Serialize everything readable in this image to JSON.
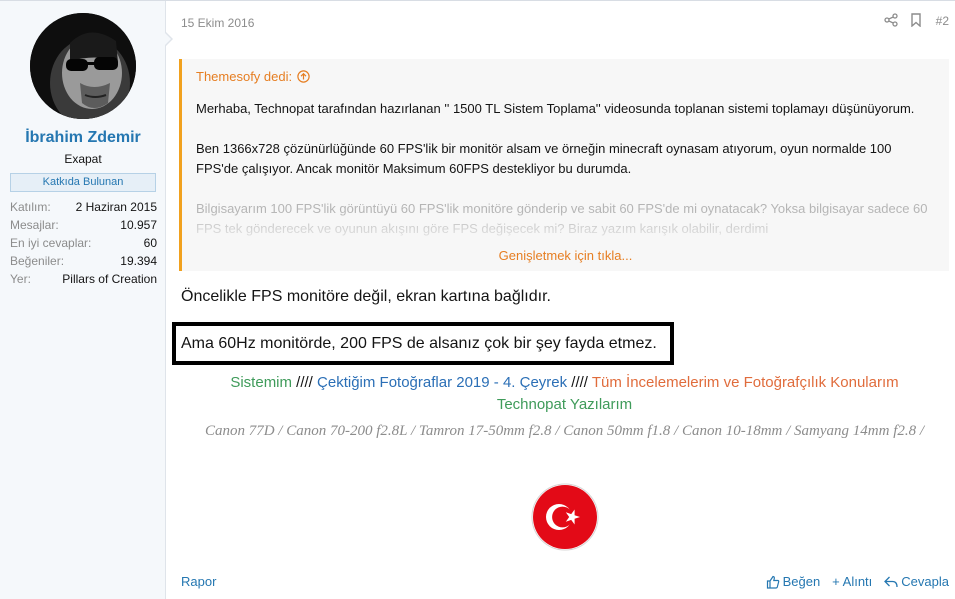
{
  "user": {
    "name": "İbrahim Zdemir",
    "title": "Exapat",
    "banner": "Katkıda Bulunan",
    "stats": [
      {
        "key": "Katılım:",
        "value": "2 Haziran 2015"
      },
      {
        "key": "Mesajlar:",
        "value": "10.957"
      },
      {
        "key": "En iyi cevaplar:",
        "value": "60"
      },
      {
        "key": "Beğeniler:",
        "value": "19.394"
      },
      {
        "key": "Yer:",
        "value": "Pillars of Creation"
      }
    ]
  },
  "post": {
    "date": "15 Ekim 2016",
    "number": "#2",
    "quote": {
      "author": "Themesofy dedi:",
      "paragraphs": [
        "Merhaba, Technopat tarafından hazırlanan '' 1500 TL Sistem Toplama'' videosunda toplanan sistemi toplamayı düşünüyorum.",
        "Ben 1366x728 çözünürlüğünde 60 FPS'lik bir monitör alsam ve örneğin minecraft oynasam atıyorum, oyun normalde 100 FPS'de çalışıyor. Ancak monitör Maksimum 60FPS destekliyor bu durumda.",
        "Bilgisayarım 100 FPS'lik görüntüyü 60 FPS'lik monitöre gönderip ve sabit 60 FPS'de mi oynatacak? Yoksa bilgisayar sadece 60 FPS tek gönderecek ve oyunun akışını göre FPS değişecek mi? Biraz yazım karışık olabilir, derdimi"
      ],
      "expand": "Genişletmek için tıkla..."
    },
    "message_line1": "Öncelikle FPS monitöre değil, ekran kartına bağlıdır.",
    "message_line2": "Ama 60Hz monitörde, 200 FPS de alsanız çok bir şey fayda etmez."
  },
  "signature": {
    "link1": "Sistemim",
    "sep": " //// ",
    "link2": "Çektiğim Fotoğraflar 2019 - 4. Çeyrek",
    "link3": "Tüm İncelemelerim ve Fotoğrafçılık Konularım",
    "link4": "Technopat Yazılarım",
    "cameras": "Canon 77D / Canon 70-200 f2.8L / Tamron 17-50mm f2.8 / Canon 50mm f1.8 / Canon 10-18mm / Samyang 14mm f2.8 /"
  },
  "footer": {
    "report": "Rapor",
    "like": "Beğen",
    "quote": "+ Alıntı",
    "reply": "Cevapla"
  },
  "colors": {
    "link": "#2577b1",
    "quote_accent": "#f1a11e",
    "sig_green": "#3f9b5a",
    "sig_blue": "#2b6fb6",
    "sig_orange": "#e06c3c",
    "flag_red": "#e30a17"
  },
  "icons": [
    "share-icon",
    "bookmark-icon",
    "circle-arrow-up-icon",
    "thumbs-up-icon",
    "reply-icon",
    "turkish-flag-icon"
  ]
}
